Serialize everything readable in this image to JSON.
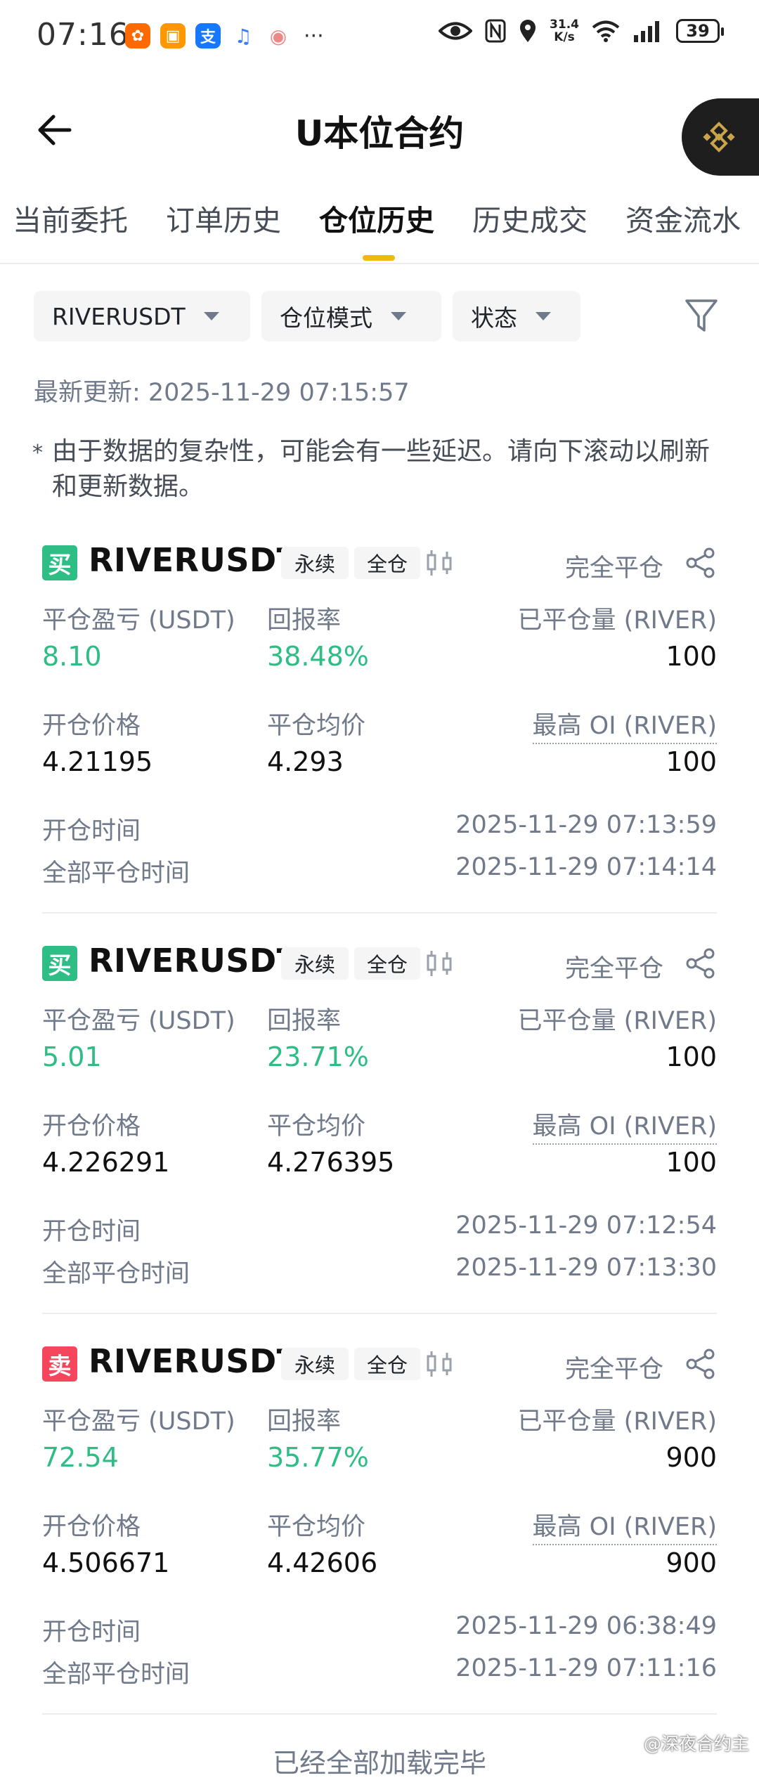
{
  "status_bar": {
    "time": "07:16",
    "net_speed_value": "31.4",
    "net_speed_unit": "K/s",
    "battery": "39",
    "more": "···"
  },
  "header": {
    "title": "U本位合约"
  },
  "tabs": [
    {
      "label": "当前委托",
      "active": false
    },
    {
      "label": "订单历史",
      "active": false
    },
    {
      "label": "仓位历史",
      "active": true
    },
    {
      "label": "历史成交",
      "active": false
    },
    {
      "label": "资金流水",
      "active": false
    }
  ],
  "filters": {
    "symbol": "RIVERUSDT",
    "mode": "仓位模式",
    "status": "状态"
  },
  "updated": "最新更新: 2025-11-29 07:15:57",
  "notice": {
    "star": "*",
    "text": "由于数据的复杂性，可能会有一些延迟。请向下滚动以刷新和更新数据。"
  },
  "labels": {
    "pnl": "平仓盈亏 (USDT)",
    "roi": "回报率",
    "closed_qty": "已平仓量 (RIVER)",
    "entry_price": "开仓价格",
    "avg_close": "平仓均价",
    "max_oi": "最高 OI (RIVER)",
    "open_time": "开仓时间",
    "close_time": "全部平仓时间"
  },
  "positions": [
    {
      "side": "买",
      "side_type": "buy",
      "symbol": "RIVERUSDT",
      "tag_type": "永续",
      "tag_margin": "全仓",
      "status": "完全平仓",
      "pnl": "8.10",
      "roi": "38.48%",
      "closed_qty": "100",
      "entry_price": "4.21195",
      "avg_close": "4.293",
      "max_oi": "100",
      "open_time": "2025-11-29 07:13:59",
      "close_time": "2025-11-29 07:14:14"
    },
    {
      "side": "买",
      "side_type": "buy",
      "symbol": "RIVERUSDT",
      "tag_type": "永续",
      "tag_margin": "全仓",
      "status": "完全平仓",
      "pnl": "5.01",
      "roi": "23.71%",
      "closed_qty": "100",
      "entry_price": "4.226291",
      "avg_close": "4.276395",
      "max_oi": "100",
      "open_time": "2025-11-29 07:12:54",
      "close_time": "2025-11-29 07:13:30"
    },
    {
      "side": "卖",
      "side_type": "sell",
      "symbol": "RIVERUSDT",
      "tag_type": "永续",
      "tag_margin": "全仓",
      "status": "完全平仓",
      "pnl": "72.54",
      "roi": "35.77%",
      "closed_qty": "900",
      "entry_price": "4.506671",
      "avg_close": "4.42606",
      "max_oi": "900",
      "open_time": "2025-11-29 06:38:49",
      "close_time": "2025-11-29 07:11:16"
    }
  ],
  "footer": "已经全部加载完毕",
  "watermark": "@深夜合约主",
  "colors": {
    "accent": "#f0b90b",
    "buy": "#2ebd85",
    "sell": "#f6465d"
  }
}
